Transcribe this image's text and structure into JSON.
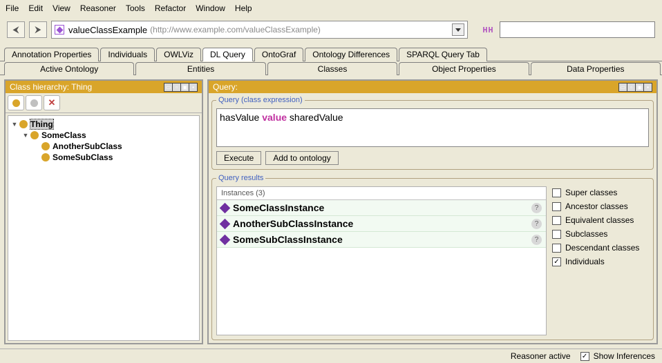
{
  "menubar": [
    "File",
    "Edit",
    "View",
    "Reasoner",
    "Tools",
    "Refactor",
    "Window",
    "Help"
  ],
  "ontology": {
    "name": "valueClassExample",
    "uri": "(http://www.example.com/valueClassExample)"
  },
  "tabs_upper": [
    {
      "label": "Annotation Properties"
    },
    {
      "label": "Individuals"
    },
    {
      "label": "OWLViz"
    },
    {
      "label": "DL Query",
      "active": true
    },
    {
      "label": "OntoGraf"
    },
    {
      "label": "Ontology Differences"
    },
    {
      "label": "SPARQL Query Tab"
    }
  ],
  "tabs_lower": [
    {
      "label": "Active Ontology"
    },
    {
      "label": "Entities"
    },
    {
      "label": "Classes"
    },
    {
      "label": "Object Properties"
    },
    {
      "label": "Data Properties"
    }
  ],
  "left_panel": {
    "title": "Class hierarchy: Thing",
    "tree": [
      {
        "label": "Thing",
        "level": 0,
        "selected": true,
        "expandable": true
      },
      {
        "label": "SomeClass",
        "level": 1,
        "expandable": true
      },
      {
        "label": "AnotherSubClass",
        "level": 2
      },
      {
        "label": "SomeSubClass",
        "level": 2
      }
    ]
  },
  "right_panel": {
    "title": "Query:",
    "expr_legend": "Query (class expression)",
    "expr": {
      "pre": "hasValue ",
      "kw": "value",
      "post": " sharedValue"
    },
    "buttons": {
      "execute": "Execute",
      "add": "Add to ontology"
    },
    "results_legend": "Query results",
    "results_header": "Instances (3)",
    "results": [
      {
        "name": "SomeClassInstance"
      },
      {
        "name": "AnotherSubClassInstance"
      },
      {
        "name": "SomeSubClassInstance"
      }
    ],
    "checkboxes": [
      {
        "label": "Super classes",
        "checked": false
      },
      {
        "label": "Ancestor classes",
        "checked": false
      },
      {
        "label": "Equivalent classes",
        "checked": false
      },
      {
        "label": "Subclasses",
        "checked": false
      },
      {
        "label": "Descendant classes",
        "checked": false
      },
      {
        "label": "Individuals",
        "checked": true
      }
    ]
  },
  "status": {
    "reasoner": "Reasoner active",
    "show_inf": "Show Inferences",
    "show_inf_checked": true
  }
}
